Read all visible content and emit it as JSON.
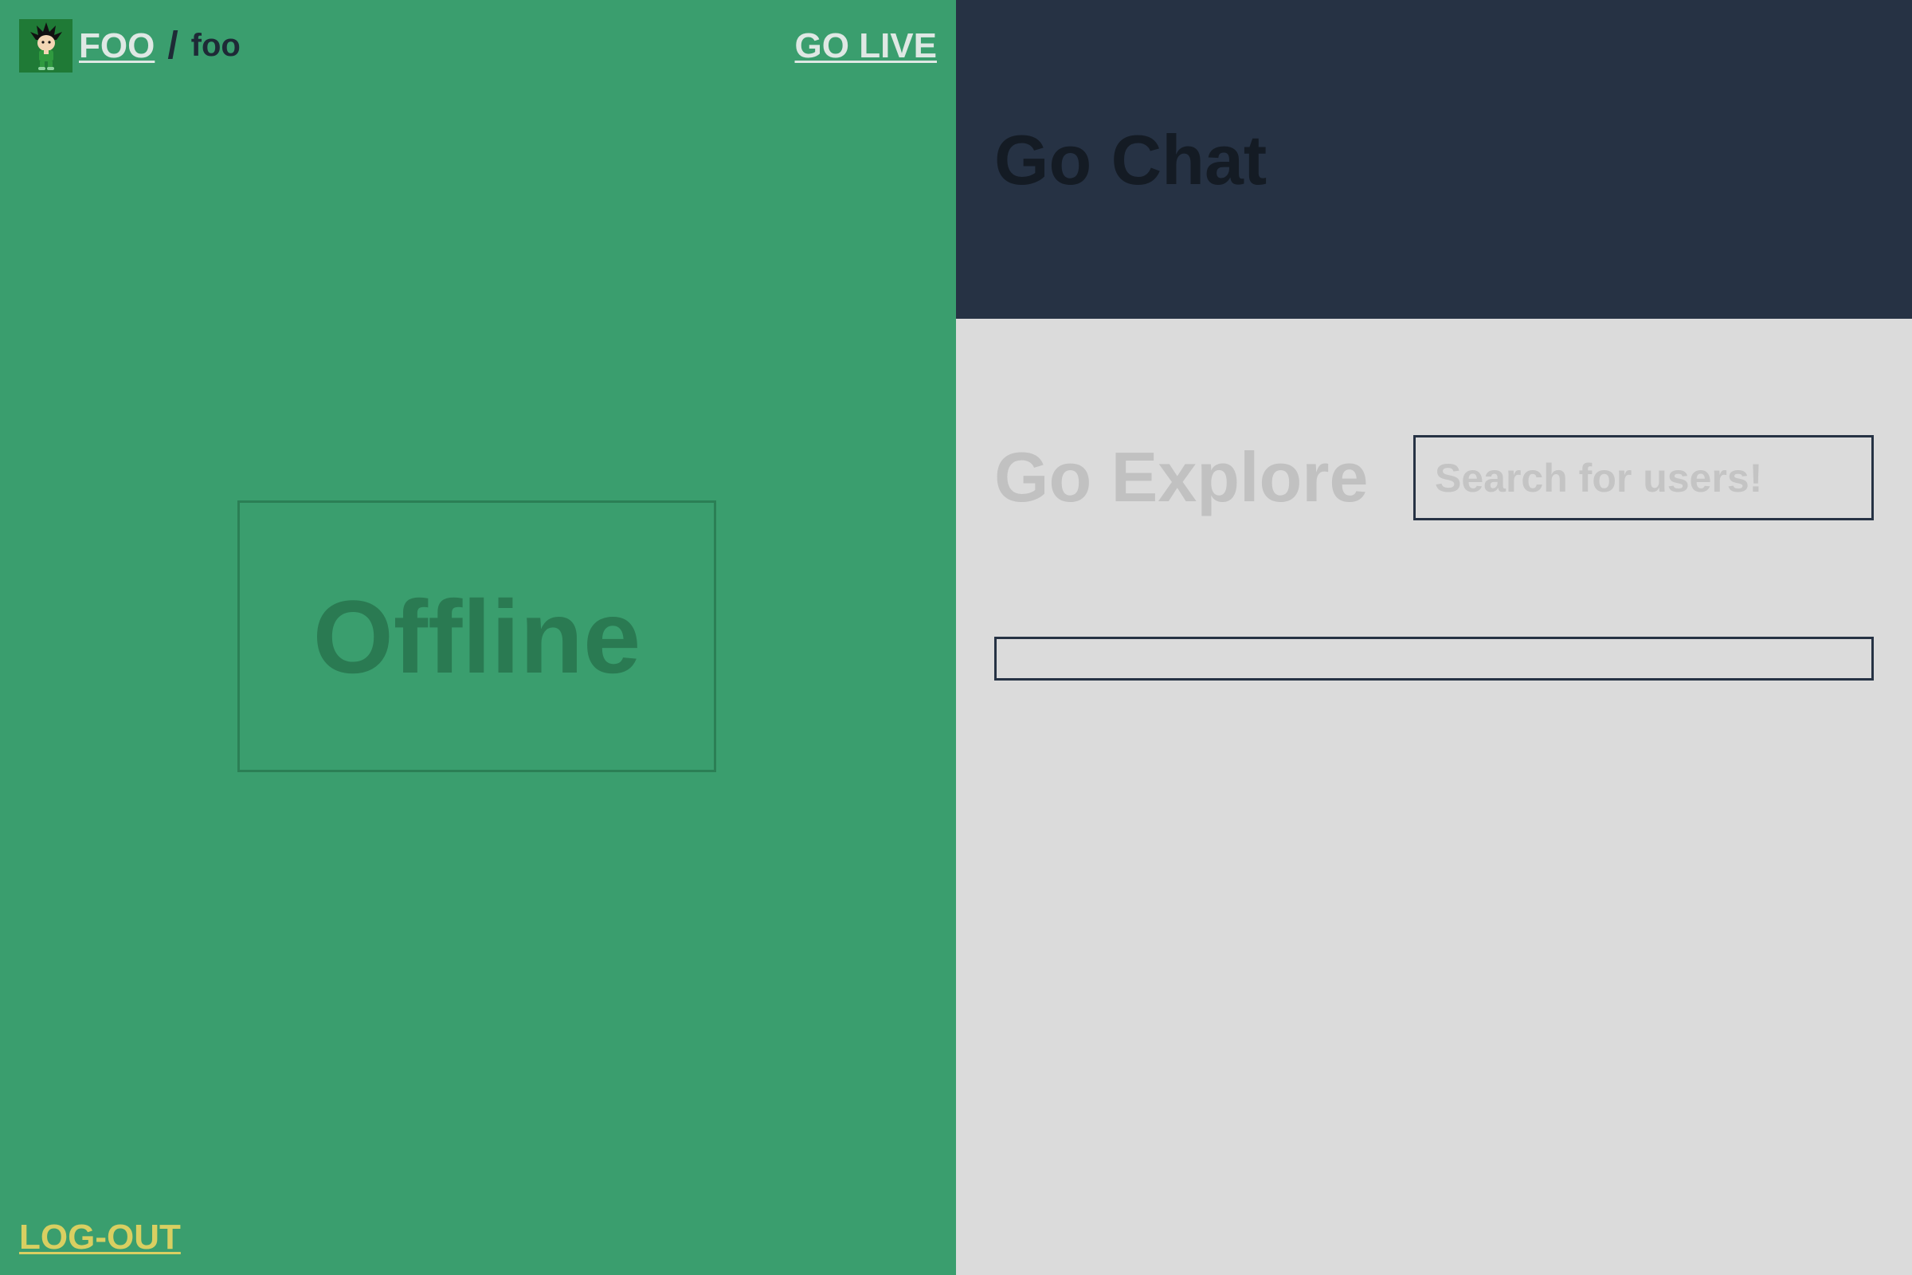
{
  "header": {
    "user_link": "FOO",
    "separator": "/",
    "channel_name": "foo",
    "go_live_label": "GO LIVE",
    "avatar_icon": "chibi-character-avatar-icon"
  },
  "stream": {
    "status_text": "Offline"
  },
  "footer": {
    "logout_label": "LOG-OUT"
  },
  "chat": {
    "title": "Go Chat"
  },
  "explore": {
    "title": "Go Explore",
    "search_placeholder": "Search for users!",
    "search_value": ""
  },
  "colors": {
    "left_bg": "#3a9e6e",
    "chat_header_bg": "#263244",
    "right_bg": "#dbdbdb",
    "logout_color": "#d9cf61",
    "avatar_bg": "#1f7a36"
  }
}
